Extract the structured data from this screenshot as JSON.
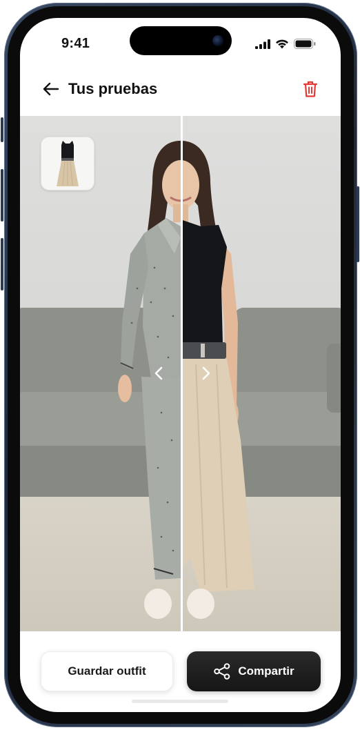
{
  "status_bar": {
    "time": "9:41",
    "icons": [
      "signal-icon",
      "wifi-icon",
      "battery-icon"
    ]
  },
  "header": {
    "back_icon": "arrow-left-icon",
    "title": "Tus pruebas",
    "delete_icon": "trash-icon"
  },
  "viewer": {
    "thumbnail_icon": "garment-thumbnail",
    "prev_icon": "chevron-left-icon",
    "next_icon": "chevron-right-icon"
  },
  "actions": {
    "save_label": "Guardar outfit",
    "share_label": "Compartir",
    "share_icon": "share-icon"
  },
  "colors": {
    "accent_delete": "#e53935",
    "primary_button": "#1c1c1c",
    "background": "#ffffff"
  }
}
